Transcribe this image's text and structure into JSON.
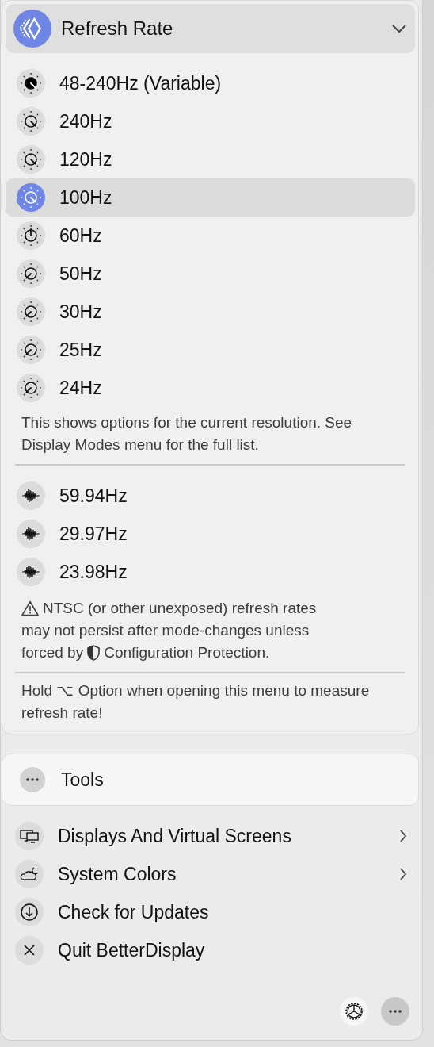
{
  "header": {
    "title": "Refresh Rate",
    "expanded": true
  },
  "rates": [
    {
      "label": "48-240Hz (Variable)",
      "kind": "filled",
      "selected": false
    },
    {
      "label": "240Hz",
      "kind": "dial-right",
      "selected": false
    },
    {
      "label": "120Hz",
      "kind": "dial-right",
      "selected": false
    },
    {
      "label": "100Hz",
      "kind": "dial-right",
      "selected": true
    },
    {
      "label": "60Hz",
      "kind": "dial-up",
      "selected": false
    },
    {
      "label": "50Hz",
      "kind": "dial-left",
      "selected": false
    },
    {
      "label": "30Hz",
      "kind": "dial-left",
      "selected": false
    },
    {
      "label": "25Hz",
      "kind": "dial-left",
      "selected": false
    },
    {
      "label": "24Hz",
      "kind": "dial-left",
      "selected": false
    }
  ],
  "rates_note": "This shows options for the current resolution. See Display Modes menu for the full list.",
  "ntsc_rates": [
    {
      "label": "59.94Hz",
      "kind": "wave",
      "selected": false
    },
    {
      "label": "29.97Hz",
      "kind": "wave",
      "selected": false
    },
    {
      "label": "23.98Hz",
      "kind": "wave",
      "selected": false
    }
  ],
  "warning": {
    "lines": [
      "NTSC (or other unexposed) refresh rates",
      "may not persist after mode-changes unless",
      "forced by"
    ],
    "link": "Configuration Protection."
  },
  "hint": "Hold ⌥ Option when opening this menu to measure refresh rate!",
  "tools": {
    "label": "Tools"
  },
  "menu_items": [
    {
      "label": "Displays And Virtual Screens",
      "kind": "displays",
      "submenu": true
    },
    {
      "label": "System Colors",
      "kind": "weather",
      "submenu": true
    },
    {
      "label": "Check for Updates",
      "kind": "download",
      "submenu": false
    },
    {
      "label": "Quit BetterDisplay",
      "kind": "quit",
      "submenu": false
    }
  ]
}
